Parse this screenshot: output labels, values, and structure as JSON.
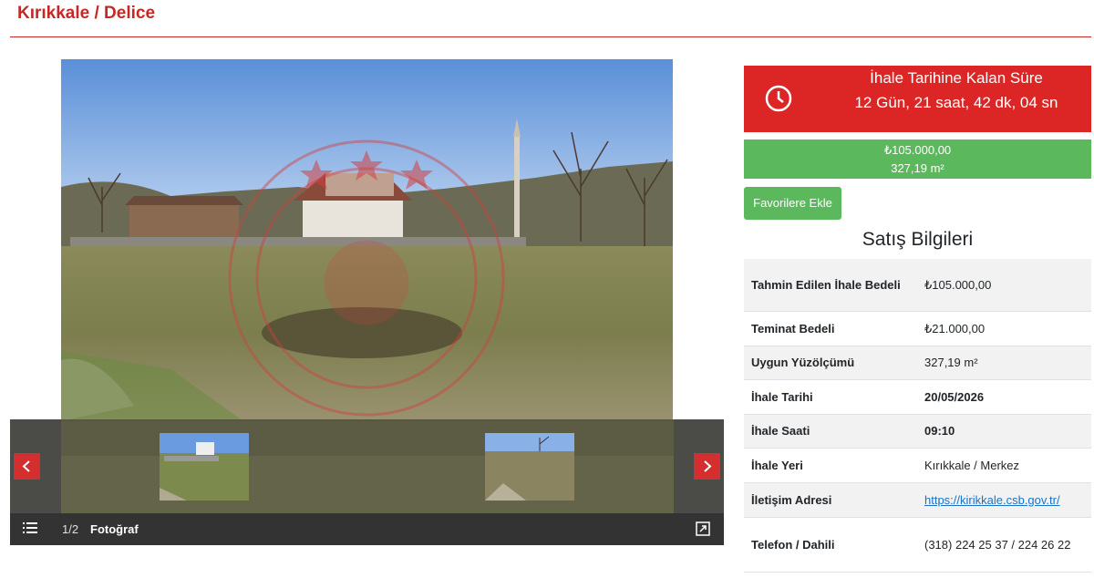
{
  "header": {
    "title": "Kırıkkale / Delice"
  },
  "gallery": {
    "counter": "1/2",
    "label": "Fotoğraf",
    "prev_icon": "chevron-left-icon",
    "next_icon": "chevron-right-icon",
    "list_icon": "list-icon",
    "expand_icon": "expand-icon"
  },
  "timer": {
    "title": "İhale Tarihine Kalan Süre",
    "remaining": "12 Gün, 21 saat, 42 dk, 04 sn",
    "icon": "clock-icon"
  },
  "price": {
    "amount": "₺105.000,00",
    "area": "327,19 m²"
  },
  "favorite_button": "Favorilere Ekle",
  "sale_info": {
    "title": "Satış Bilgileri",
    "rows": [
      {
        "key": "Tahmin Edilen İhale Bedeli",
        "value": "₺105.000,00"
      },
      {
        "key": "Teminat Bedeli",
        "value": "₺21.000,00"
      },
      {
        "key": "Uygun Yüzölçümü",
        "value": "327,19 m²"
      },
      {
        "key": "İhale Tarihi",
        "value": "20/05/2026"
      },
      {
        "key": "İhale Saati",
        "value": "09:10"
      },
      {
        "key": "İhale Yeri",
        "value": "Kırıkkale / Merkez"
      },
      {
        "key": "İletişim Adresi",
        "value": "https://kirikkale.csb.gov.tr/"
      },
      {
        "key": "Telefon / Dahili",
        "value": "(318) 224 25 37 / 224 26 22"
      }
    ]
  },
  "colors": {
    "accent_red": "#dc2626",
    "accent_green": "#5cb85c",
    "link": "#1a73c8"
  }
}
